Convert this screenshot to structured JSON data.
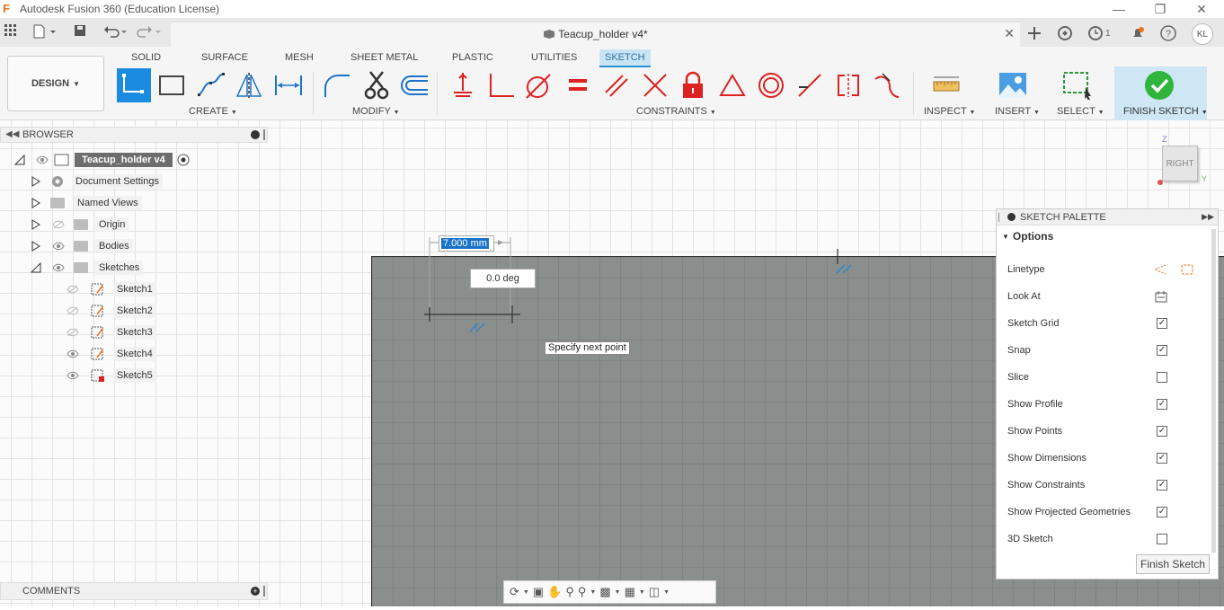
{
  "window": {
    "title": "Autodesk Fusion 360 (Education License)"
  },
  "document": {
    "title": "Teacup_holder v4*"
  },
  "header": {
    "job_count": "1",
    "user_initials": "KL"
  },
  "toolbar": {
    "design_label": "DESIGN",
    "tabs": [
      "SOLID",
      "SURFACE",
      "MESH",
      "SHEET METAL",
      "PLASTIC",
      "UTILITIES",
      "SKETCH"
    ],
    "groups": {
      "create": "CREATE",
      "modify": "MODIFY",
      "constraints": "CONSTRAINTS",
      "inspect": "INSPECT",
      "insert": "INSERT",
      "select": "SELECT",
      "finish": "FINISH SKETCH"
    }
  },
  "browser": {
    "title": "BROWSER",
    "root": "Teacup_holder v4",
    "items": [
      "Document Settings",
      "Named Views",
      "Origin",
      "Bodies",
      "Sketches"
    ],
    "sketches": [
      "Sketch1",
      "Sketch2",
      "Sketch3",
      "Sketch4",
      "Sketch5"
    ]
  },
  "comments": {
    "title": "COMMENTS"
  },
  "canvas": {
    "dimension_value": "7.000 mm",
    "angle_value": "0.0 deg",
    "tooltip": "Specify next point",
    "viewcube_label": "RIGHT",
    "axis_z": "Z",
    "axis_y": "Y"
  },
  "palette": {
    "title": "SKETCH PALETTE",
    "options_label": "Options",
    "rows": [
      {
        "label": "Linetype",
        "control": "icons"
      },
      {
        "label": "Look At",
        "control": "icon"
      },
      {
        "label": "Sketch Grid",
        "checked": true
      },
      {
        "label": "Snap",
        "checked": true
      },
      {
        "label": "Slice",
        "checked": false
      },
      {
        "label": "Show Profile",
        "checked": true
      },
      {
        "label": "Show Points",
        "checked": true
      },
      {
        "label": "Show Dimensions",
        "checked": true
      },
      {
        "label": "Show Constraints",
        "checked": true
      },
      {
        "label": "Show Projected Geometries",
        "checked": true
      },
      {
        "label": "3D Sketch",
        "checked": false
      }
    ],
    "finish_button": "Finish Sketch"
  }
}
